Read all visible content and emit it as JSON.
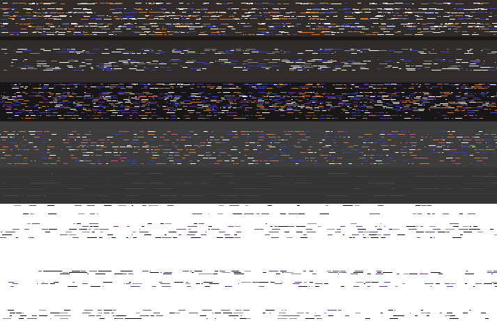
{
  "screen": {
    "state": "corrupted-render",
    "palette": {
      "dark_band_1": "#2e2826",
      "dark_band_2": "#1c1817",
      "dark_band_3": "#2f2a29",
      "dark_band_4": "#151313",
      "gray_band_1": "#3a3a3a",
      "gray_band_2": "#323232",
      "light_area": "#ffffff",
      "artifact_orange": "#e07a2a",
      "artifact_blue": "#3344cc",
      "artifact_purple": "#6a2a9a",
      "artifact_white": "#ffffff",
      "artifact_gray": "#888888",
      "artifact_pink": "#cc5577",
      "artifact_black": "#000000"
    }
  }
}
